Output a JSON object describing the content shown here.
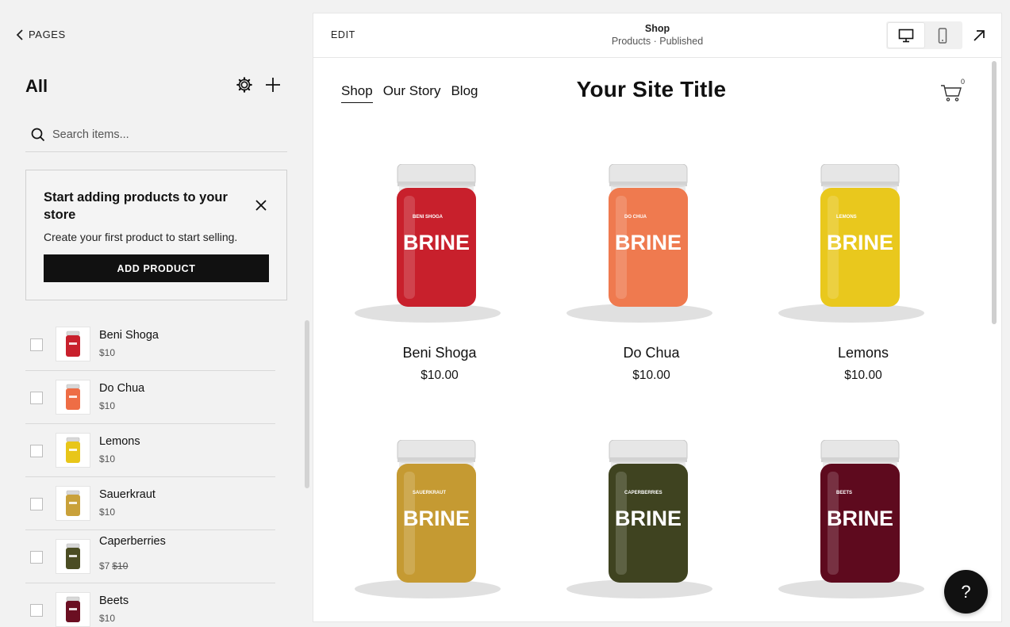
{
  "sidebar": {
    "back_label": "PAGES",
    "title": "All",
    "search_placeholder": "Search items...",
    "promo": {
      "title": "Start adding products to your store",
      "description": "Create your first product to start selling.",
      "button": "ADD PRODUCT"
    },
    "items": [
      {
        "name": "Beni Shoga",
        "price": "$10",
        "color": "#c8202c"
      },
      {
        "name": "Do Chua",
        "price": "$10",
        "color": "#ee6d45"
      },
      {
        "name": "Lemons",
        "price": "$10",
        "color": "#e8c619"
      },
      {
        "name": "Sauerkraut",
        "price": "$10",
        "color": "#c9a13a"
      },
      {
        "name": "Caperberries",
        "price": "$7",
        "old_price": "$10",
        "color": "#4b4d23"
      },
      {
        "name": "Beets",
        "price": "$10",
        "color": "#6b0f22"
      }
    ]
  },
  "preview": {
    "edit_label": "EDIT",
    "page_title": "Shop",
    "page_status": "Products · Published",
    "site": {
      "title": "Your Site Title",
      "nav": [
        "Shop",
        "Our Story",
        "Blog"
      ],
      "cart_count": "0",
      "jar_brand": "BRINE"
    },
    "products": [
      {
        "name": "Beni Shoga",
        "price": "$10.00",
        "color": "#c8202c",
        "label": "BENI SHOGA"
      },
      {
        "name": "Do Chua",
        "price": "$10.00",
        "color": "#ef7a4f",
        "label": "DO CHUA"
      },
      {
        "name": "Lemons",
        "price": "$10.00",
        "color": "#e9c81d",
        "label": "LEMONS"
      },
      {
        "name": "",
        "price": "",
        "color": "#c59a32",
        "label": "SAUERKRAUT"
      },
      {
        "name": "",
        "price": "",
        "color": "#3f4320",
        "label": "CAPERBERRIES"
      },
      {
        "name": "",
        "price": "",
        "color": "#5e0a1e",
        "label": "BEETS"
      }
    ]
  },
  "help_label": "?"
}
